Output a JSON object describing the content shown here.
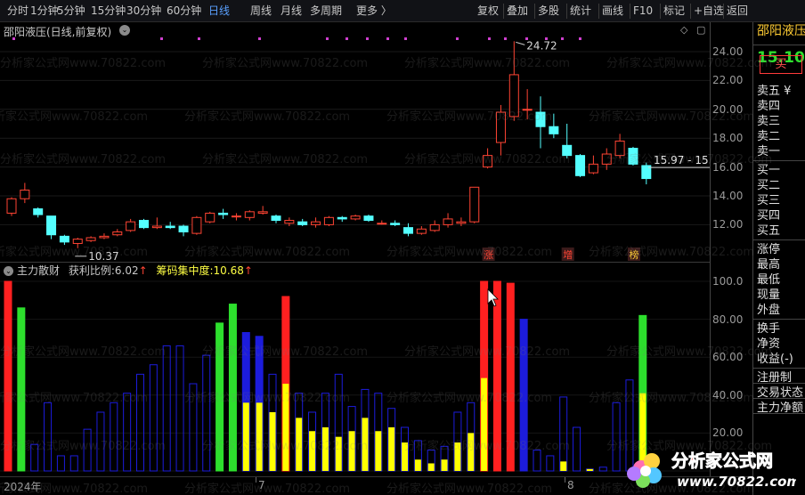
{
  "toolbar": {
    "left": [
      "分时",
      "1分钟",
      "5分钟",
      "15分钟",
      "30分钟",
      "60分钟",
      "日线",
      "周线",
      "月线",
      "多周期",
      "更多 〉"
    ],
    "active": "日线",
    "right": [
      "复权",
      "叠加",
      "多股",
      "统计",
      "画线",
      "F10",
      "标记",
      "+自选",
      "返回"
    ]
  },
  "chart": {
    "title": "邵阳液压(日线,前复权)",
    "dropdown": "⌄",
    "high_label": "24.72",
    "low_label": "10.37",
    "last_label": "15.97 - 15.",
    "markers": [
      "涨",
      "增",
      "榜"
    ],
    "y_ticks": [
      "24.00",
      "22.00",
      "20.00",
      "18.00",
      "16.00",
      "14.00",
      "12.00"
    ]
  },
  "candles": [
    [
      12.8,
      13.8,
      13.9,
      12.6
    ],
    [
      13.8,
      14.4,
      14.9,
      13.5
    ],
    [
      13.1,
      12.7,
      13.2,
      12.5
    ],
    [
      12.6,
      11.3,
      12.6,
      11.0
    ],
    [
      11.2,
      10.8,
      11.3,
      10.6
    ],
    [
      10.7,
      11.0,
      11.1,
      10.37
    ],
    [
      10.9,
      11.1,
      11.2,
      10.8
    ],
    [
      11.1,
      11.2,
      11.4,
      11.0
    ],
    [
      11.3,
      11.5,
      11.7,
      11.2
    ],
    [
      11.6,
      12.2,
      12.4,
      11.5
    ],
    [
      12.3,
      11.8,
      12.4,
      11.7
    ],
    [
      11.8,
      11.9,
      12.5,
      11.7
    ],
    [
      11.9,
      11.8,
      12.2,
      11.7
    ],
    [
      11.9,
      11.5,
      12.0,
      11.2
    ],
    [
      11.4,
      12.5,
      12.6,
      11.3
    ],
    [
      12.2,
      12.8,
      12.9,
      12.1
    ],
    [
      12.8,
      12.7,
      13.1,
      12.4
    ],
    [
      12.6,
      12.6,
      12.8,
      12.3
    ],
    [
      12.5,
      12.9,
      13.0,
      12.3
    ],
    [
      12.8,
      12.9,
      13.3,
      12.7
    ],
    [
      12.6,
      12.3,
      12.7,
      12.1
    ],
    [
      12.1,
      12.3,
      12.5,
      11.9
    ],
    [
      12.2,
      12.0,
      12.4,
      11.9
    ],
    [
      12.0,
      12.2,
      12.5,
      11.8
    ],
    [
      12.0,
      12.5,
      12.6,
      11.9
    ],
    [
      12.5,
      12.4,
      12.6,
      12.2
    ],
    [
      12.4,
      12.6,
      12.7,
      12.3
    ],
    [
      12.6,
      12.3,
      12.7,
      12.2
    ],
    [
      12.1,
      12.1,
      12.3,
      12.0
    ],
    [
      12.1,
      12.0,
      12.3,
      11.9
    ],
    [
      11.8,
      11.4,
      12.1,
      11.2
    ],
    [
      11.4,
      11.7,
      11.9,
      11.3
    ],
    [
      11.6,
      12.0,
      12.3,
      11.5
    ],
    [
      12.0,
      12.4,
      12.8,
      11.8
    ],
    [
      12.1,
      12.2,
      12.5,
      11.9
    ],
    [
      12.2,
      14.6,
      14.6,
      12.1
    ],
    [
      16.0,
      16.8,
      17.3,
      15.9
    ],
    [
      17.7,
      19.8,
      20.3,
      16.8
    ],
    [
      19.5,
      22.4,
      24.72,
      19.2
    ],
    [
      20.0,
      20.0,
      21.4,
      19.3
    ],
    [
      19.8,
      18.8,
      20.9,
      17.3
    ],
    [
      18.8,
      18.3,
      19.7,
      18.0
    ],
    [
      17.5,
      16.8,
      19.0,
      16.6
    ],
    [
      16.8,
      15.4,
      16.9,
      15.3
    ],
    [
      15.6,
      16.2,
      16.8,
      15.5
    ],
    [
      16.2,
      16.9,
      17.3,
      15.8
    ],
    [
      16.8,
      17.8,
      18.3,
      16.6
    ],
    [
      17.3,
      16.2,
      17.4,
      16.1
    ],
    [
      16.1,
      15.2,
      16.3,
      14.8
    ]
  ],
  "indicator": {
    "title": "主力散财",
    "label1": "获利比例:",
    "value1": "6.02",
    "arrow1": "↑",
    "label2": "筹码集中度:",
    "value2": "10.68",
    "arrow2": "↑",
    "y_ticks": [
      "100.0",
      "80.00",
      "60.00",
      "40.00",
      "20.00"
    ],
    "bars": [
      [
        100,
        0,
        "red"
      ],
      [
        86,
        0,
        "green"
      ],
      [
        14,
        0,
        "none"
      ],
      [
        36,
        0,
        "none"
      ],
      [
        8,
        0,
        "none"
      ],
      [
        8,
        0,
        "none"
      ],
      [
        22,
        0,
        "none"
      ],
      [
        31,
        0,
        "none"
      ],
      [
        36,
        0,
        "none"
      ],
      [
        41,
        0,
        "none"
      ],
      [
        51,
        0,
        "none"
      ],
      [
        56,
        0,
        "none"
      ],
      [
        66,
        0,
        "none"
      ],
      [
        66,
        0,
        "none"
      ],
      [
        46,
        0,
        "none"
      ],
      [
        61,
        0,
        "none"
      ],
      [
        78,
        0,
        "green"
      ],
      [
        88,
        0,
        "green"
      ],
      [
        73,
        36,
        "blue"
      ],
      [
        71,
        36,
        "blue"
      ],
      [
        51,
        31,
        "none"
      ],
      [
        92,
        46,
        "red"
      ],
      [
        41,
        28,
        "none"
      ],
      [
        31,
        21,
        "none"
      ],
      [
        41,
        23,
        "none"
      ],
      [
        51,
        18,
        "none"
      ],
      [
        34,
        21,
        "none"
      ],
      [
        43,
        28,
        "none"
      ],
      [
        41,
        21,
        "none"
      ],
      [
        33,
        23,
        "none"
      ],
      [
        23,
        15,
        "none"
      ],
      [
        16,
        6,
        "none"
      ],
      [
        11,
        4,
        "none"
      ],
      [
        13,
        6,
        "none"
      ],
      [
        31,
        15,
        "none"
      ],
      [
        36,
        20,
        "none"
      ],
      [
        100,
        49,
        "red"
      ],
      [
        100,
        0,
        "red"
      ],
      [
        99,
        0,
        "red"
      ],
      [
        80,
        0,
        "blue"
      ],
      [
        11,
        0,
        "none"
      ],
      [
        8,
        0,
        "none"
      ],
      [
        39,
        5,
        "none"
      ],
      [
        23,
        0,
        "none"
      ],
      [
        1,
        1,
        "none"
      ],
      [
        2,
        0,
        "none"
      ],
      [
        36,
        0,
        "none"
      ],
      [
        48,
        0,
        "none"
      ],
      [
        82,
        41,
        "green"
      ]
    ]
  },
  "right_panel": {
    "name": "邵阳液压",
    "price": "15.10",
    "sell_button": "买",
    "items": [
      "卖五 ¥",
      "卖四",
      "卖三",
      "卖二",
      "卖一",
      "买一",
      "买二",
      "买三",
      "买四",
      "买五",
      "涨停",
      "最高",
      "最低",
      "现量",
      "外盘",
      "换手",
      "净资",
      "收益(-)",
      "注册制",
      "交易状态",
      "主力净额"
    ]
  },
  "date_axis": [
    "2024年",
    "7",
    "8"
  ],
  "watermark": "分析家公式网www.70822.com",
  "logo": {
    "text1": "分析家公式网",
    "text2": "www.70822.com"
  },
  "colors": {
    "up": "#ff4433",
    "down": "#54ffff",
    "blue": "#1c1cdc",
    "yellow": "#ffff00",
    "green": "#2ddf2d",
    "red": "#ff2020"
  }
}
